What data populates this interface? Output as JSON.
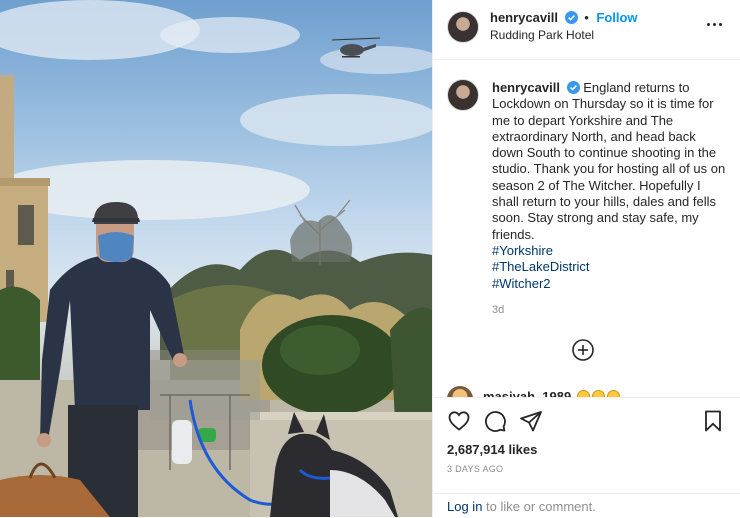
{
  "post": {
    "header": {
      "username": "henrycavill",
      "separator": "•",
      "follow_label": "Follow",
      "location": "Rudding Park Hotel"
    },
    "caption": {
      "username": "henrycavill",
      "text": "England returns to Lockdown on Thursday so it is time for me to depart Yorkshire and The extraordinary North, and head back down South to continue shooting in the studio. Thank you for hosting all of us on season 2 of The Witcher. Hopefully I shall return to your hills, dales and fells soon. Stay strong and stay safe, my friends.",
      "hashtags": [
        "#Yorkshire",
        "#TheLakeDistrict",
        "#Witcher2"
      ],
      "age": "3d"
    },
    "partial_comment": {
      "username_visible": "masiyah_1989"
    },
    "likes_text": "2,687,914 likes",
    "date": "3 DAYS AGO",
    "login": {
      "link": "Log in",
      "rest": " to like or comment."
    }
  },
  "colors": {
    "link_blue": "#0095f6",
    "hashtag_blue": "#00376b",
    "verified_blue": "#3897f0",
    "muted_gray": "#8e8e8e",
    "text": "#262626"
  },
  "icons": {
    "more": "more-options-icon",
    "load_more": "plus-circle-icon",
    "like": "heart-icon",
    "comment": "comment-icon",
    "share": "paper-plane-icon",
    "save": "bookmark-icon",
    "verified": "verified-badge-icon"
  }
}
